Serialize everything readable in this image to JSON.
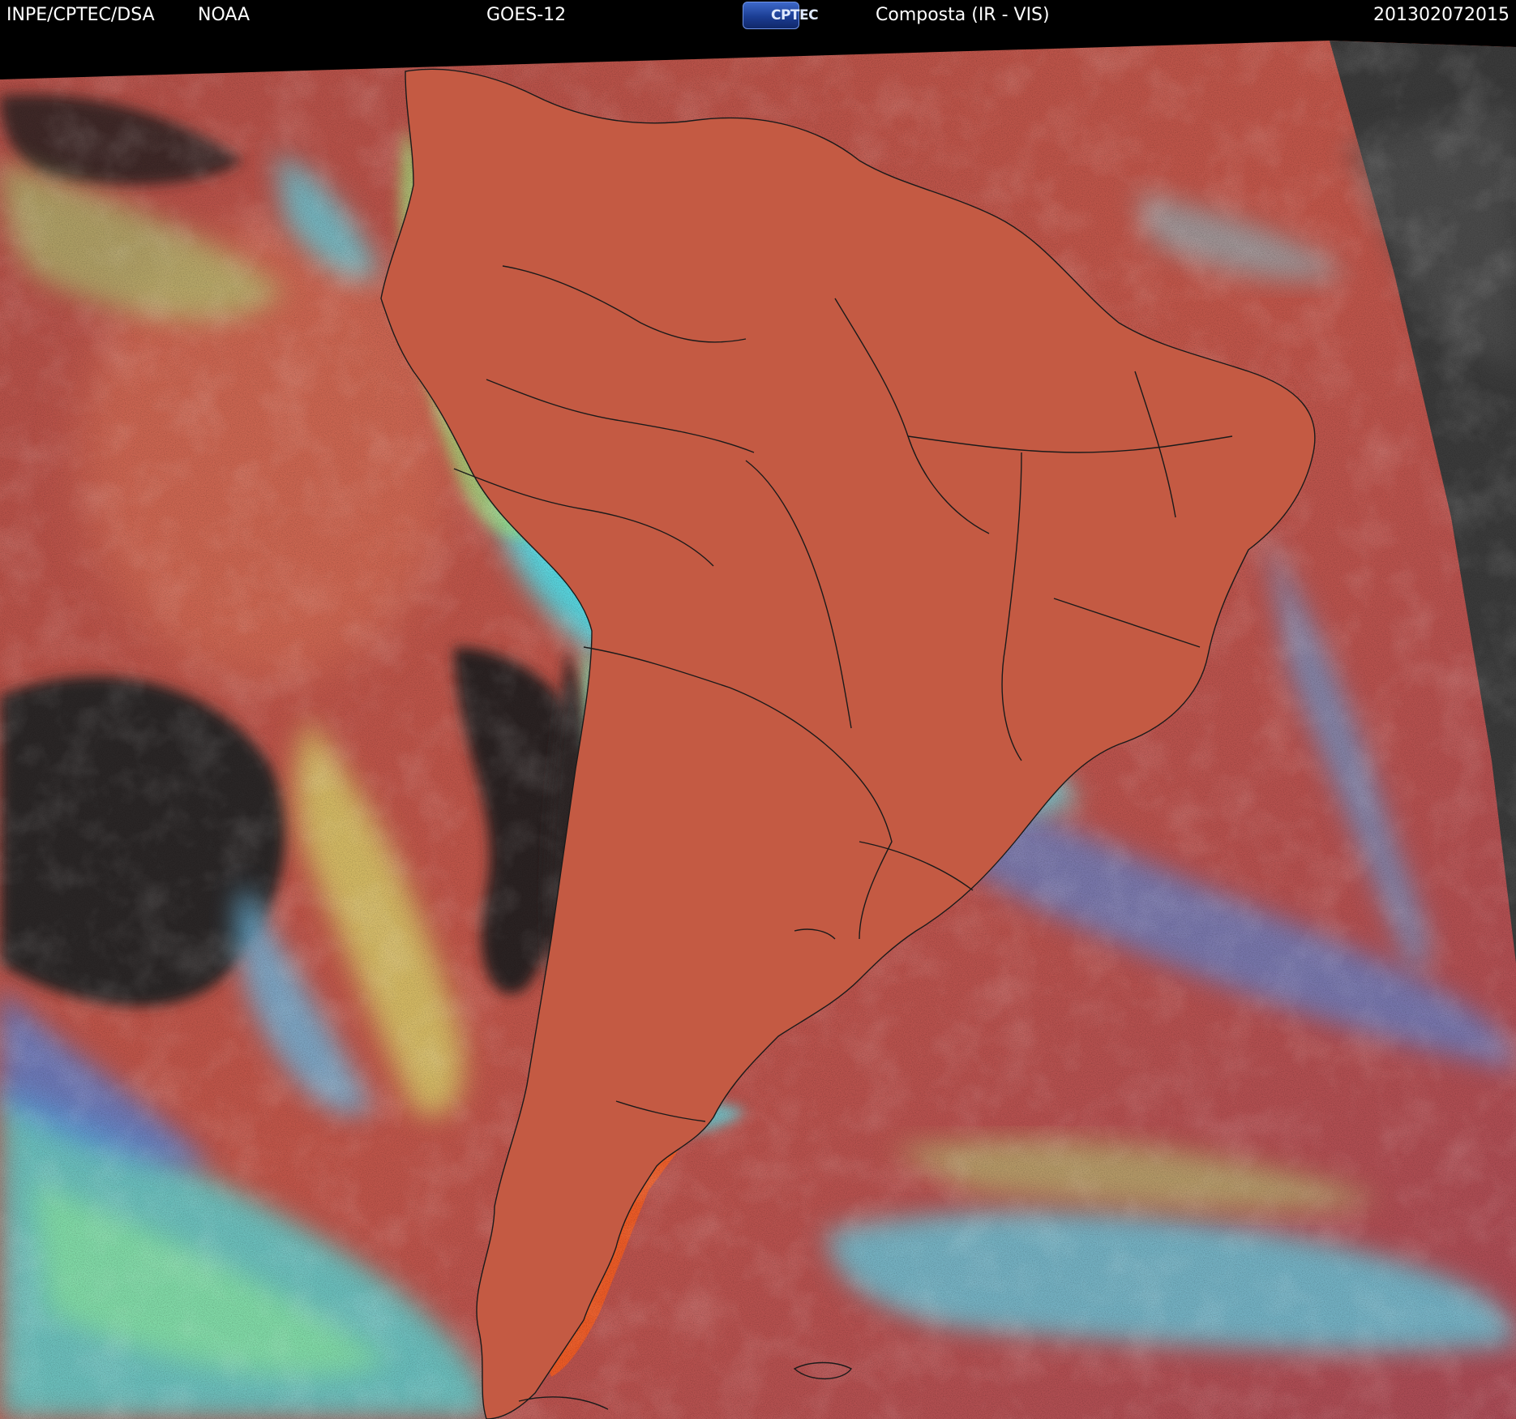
{
  "header": {
    "organization": "INPE/CPTEC/DSA",
    "agency": "NOAA",
    "satellite": "GOES-12",
    "logo_text": "CPTEC",
    "product": "Composta (IR - VIS)",
    "timestamp": "201302072015"
  },
  "colors": {
    "ocean_red": "#b8524a",
    "clear_land_orange": "#e0552d",
    "cloud_cyan": "#45e6f2",
    "cloud_green": "#9ee37d",
    "cloud_blue": "#4f86e6",
    "night_dark": "#2a2a2a",
    "night_gray": "#3b3b3b",
    "border_line": "#1a1a1a"
  }
}
